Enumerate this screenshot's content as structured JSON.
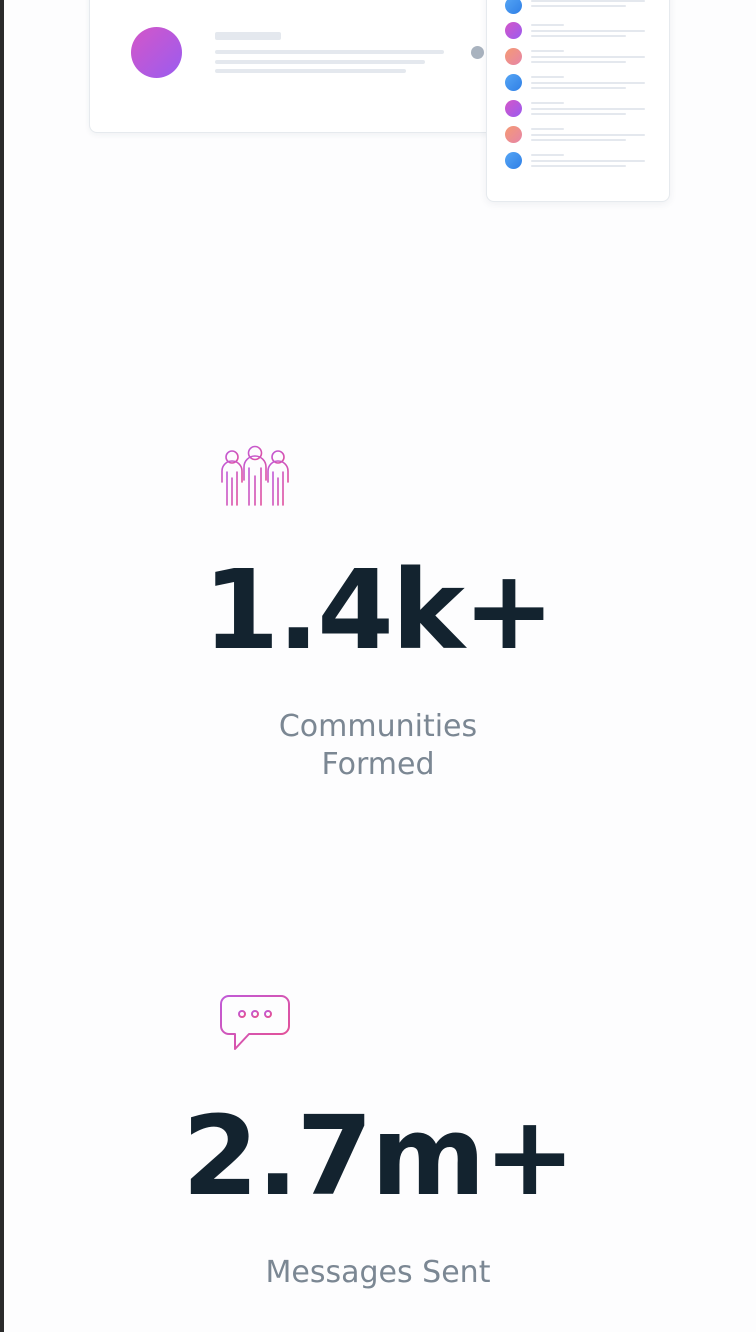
{
  "colors": {
    "accent_purple": "#b44fd6",
    "accent_pink": "#e0509e",
    "accent_blue": "#3f8fee",
    "accent_orange": "#ee9a7f",
    "heading": "#13232f",
    "muted_text": "#7b8793"
  },
  "stats": [
    {
      "icon": "community-icon",
      "value": "1.4k+",
      "label_line1": "Communities",
      "label_line2": "Formed"
    },
    {
      "icon": "chat-bubble-icon",
      "value": "2.7m+",
      "label": "Messages Sent"
    }
  ]
}
